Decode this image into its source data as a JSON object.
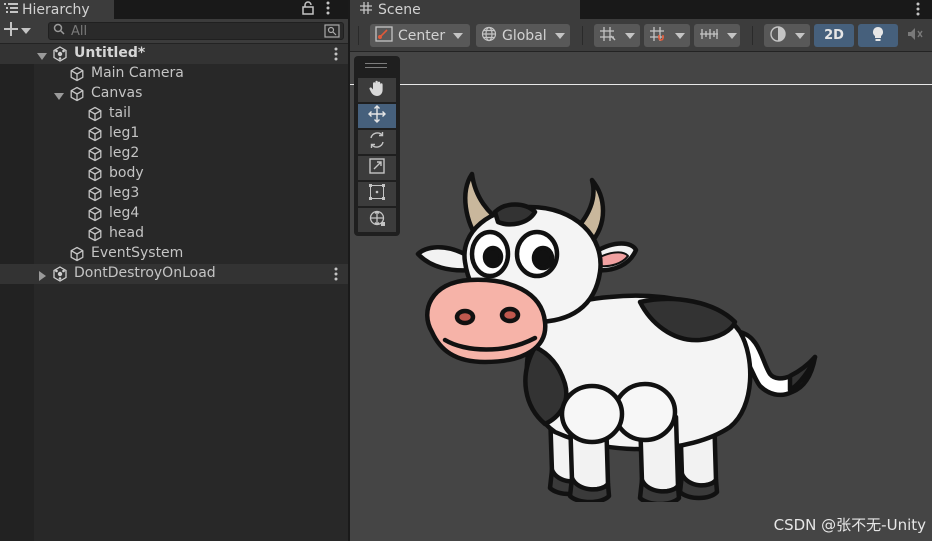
{
  "hierarchy": {
    "tab_title": "Hierarchy",
    "search": {
      "placeholder": "All"
    },
    "items": [
      {
        "label": "Untitled*",
        "type": "scene",
        "expanded": true,
        "depth": 0
      },
      {
        "label": "Main Camera",
        "type": "gameobject",
        "depth": 1
      },
      {
        "label": "Canvas",
        "type": "gameobject",
        "expanded": true,
        "depth": 1
      },
      {
        "label": "tail",
        "type": "gameobject",
        "depth": 2
      },
      {
        "label": "leg1",
        "type": "gameobject",
        "depth": 2
      },
      {
        "label": "leg2",
        "type": "gameobject",
        "depth": 2
      },
      {
        "label": "body",
        "type": "gameobject",
        "depth": 2
      },
      {
        "label": "leg3",
        "type": "gameobject",
        "depth": 2
      },
      {
        "label": "leg4",
        "type": "gameobject",
        "depth": 2
      },
      {
        "label": "head",
        "type": "gameobject",
        "depth": 2
      },
      {
        "label": "EventSystem",
        "type": "gameobject",
        "depth": 1
      },
      {
        "label": "DontDestroyOnLoad",
        "type": "scene",
        "expanded": false,
        "depth": 0
      }
    ]
  },
  "scene": {
    "tab_title": "Scene",
    "toolbar": {
      "pivot_label": "Center",
      "space_label": "Global",
      "mode_2d_label": "2D"
    },
    "active_tool": "move",
    "tools": [
      "view-hand",
      "move",
      "rotate",
      "scale",
      "rect",
      "transform"
    ]
  },
  "watermark": "CSDN @张不无-Unity",
  "colors": {
    "accent": "#46607c",
    "panel_bg": "#282828",
    "scene_bg": "#454545",
    "toolbar_bg": "#3c3c3c"
  }
}
